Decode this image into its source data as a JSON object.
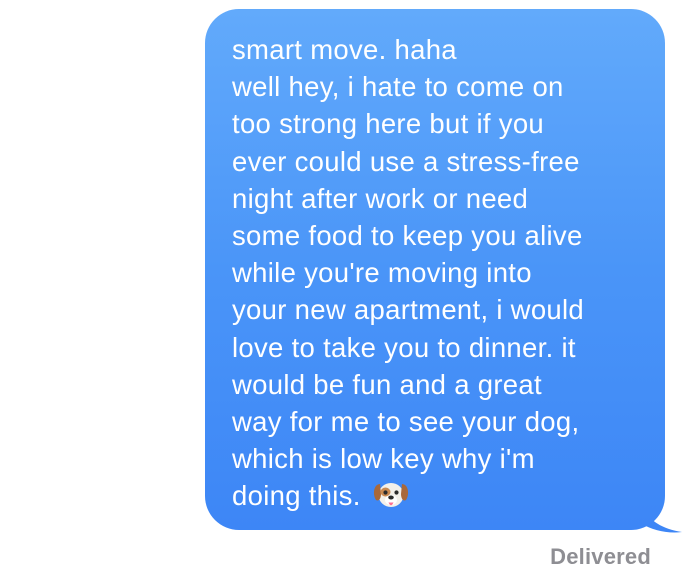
{
  "message": {
    "lines": [
      "smart move. haha",
      "well hey, i hate to come on",
      "too strong here but if you",
      "ever could use a stress-free",
      "night after work or need",
      "some food to keep you alive",
      "while you're moving into",
      "your new apartment, i would",
      "love to take you to dinner. it",
      "would be fun and a great",
      "way for me to see your dog,",
      "which is low key why i'm",
      "doing this."
    ],
    "emoji": "dog-face-icon",
    "sender": "outgoing"
  },
  "status": {
    "receipt": "Delivered"
  },
  "colors": {
    "bubble_top": "#62aafb",
    "bubble_bottom": "#3d86f6",
    "text": "#ffffff",
    "receipt": "#8e8e93",
    "background": "#ffffff"
  }
}
